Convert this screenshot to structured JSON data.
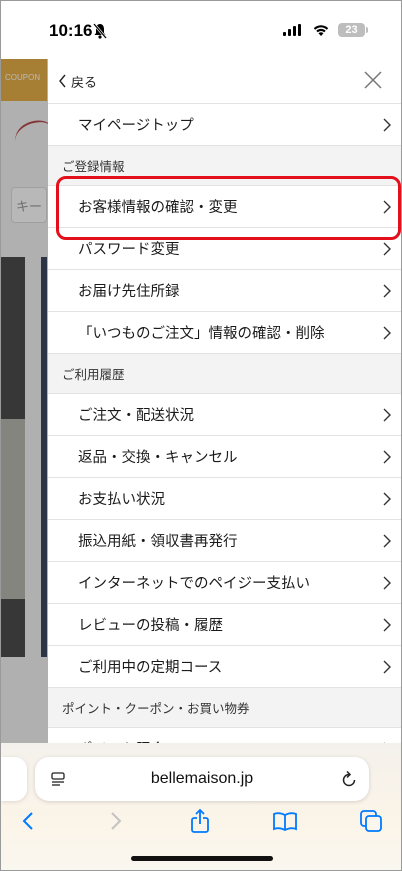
{
  "status_bar": {
    "time": "10:16",
    "battery": "23"
  },
  "background_page": {
    "coupon_text": "COUPON",
    "search_placeholder": "キー"
  },
  "drawer": {
    "back_label": "戻る",
    "top_items": [
      {
        "label": "マイページトップ"
      }
    ],
    "sections": [
      {
        "title": "ご登録情報",
        "items": [
          {
            "label": "お客様情報の確認・変更",
            "highlighted": true
          },
          {
            "label": "パスワード変更"
          },
          {
            "label": "お届け先住所録"
          },
          {
            "label": "「いつものご注文」情報の確認・削除"
          }
        ]
      },
      {
        "title": "ご利用履歴",
        "items": [
          {
            "label": "ご注文・配送状況"
          },
          {
            "label": "返品・交換・キャンセル"
          },
          {
            "label": "お支払い状況"
          },
          {
            "label": "振込用紙・領収書再発行"
          },
          {
            "label": "インターネットでのペイジー支払い"
          },
          {
            "label": "レビューの投稿・履歴"
          },
          {
            "label": "ご利用中の定期コース"
          }
        ]
      },
      {
        "title": "ポイント・クーポン・お買い物券",
        "items": [
          {
            "label": "ポイント照会"
          }
        ]
      }
    ]
  },
  "browser": {
    "url": "bellemaison.jp",
    "accent_color": "#007aff",
    "highlight_color": "#e3101b"
  },
  "icons": {
    "back": "chevron-left-icon",
    "close": "close-x-icon",
    "row_chevron": "chevron-right-icon",
    "reader": "reader-mode-icon",
    "reload": "reload-icon",
    "nav_back": "back-arrow-icon",
    "nav_forward": "forward-arrow-icon",
    "share": "share-icon",
    "bookmarks": "bookmarks-icon",
    "tabs": "tabs-icon"
  }
}
